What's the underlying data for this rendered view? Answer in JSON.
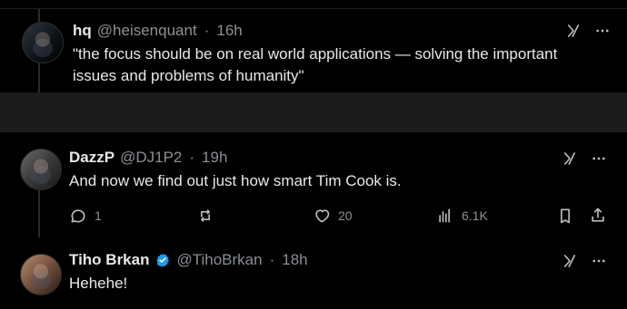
{
  "posts": [
    {
      "name": "hq",
      "handle": "@heisenquant",
      "time": "16h",
      "text": "\"the focus should be on real world applications — solving the important\nissues and problems of humanity\""
    },
    {
      "name": "DazzP",
      "handle": "@DJ1P2",
      "time": "19h",
      "text": "And now we find out just how smart Tim Cook is.",
      "actions": {
        "replies": "1",
        "reposts": "",
        "likes": "20",
        "views": "6.1K"
      }
    },
    {
      "name": "Tiho Brkan",
      "handle": "@TihoBrkan",
      "time": "18h",
      "text": "Hehehe!",
      "verified": true
    }
  ],
  "separator": "·",
  "icons": {
    "grok": "grok-icon",
    "more": "more-icon",
    "reply": "reply-icon",
    "repost": "repost-icon",
    "like": "like-icon",
    "views": "views-icon",
    "bookmark": "bookmark-icon",
    "share": "share-icon",
    "verified": "verified-badge-icon"
  },
  "colors": {
    "background": "#000000",
    "text": "#e7e9ea",
    "muted": "#8b8f94",
    "verified": "#1d9bf0"
  }
}
